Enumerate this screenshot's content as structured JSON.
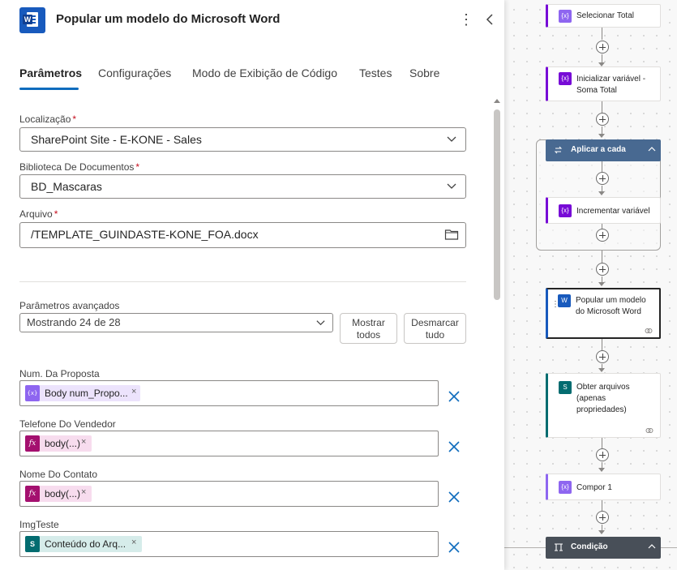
{
  "header": {
    "title": "Popular um modelo do Microsoft Word",
    "more_icon": "more-vertical-icon",
    "collapse_icon": "chevron-left-icon"
  },
  "tabs": [
    {
      "label": "Parâmetros",
      "active": true
    },
    {
      "label": "Configurações",
      "active": false
    },
    {
      "label": "Modo de Exibição de Código",
      "active": false
    },
    {
      "label": "Testes",
      "active": false
    },
    {
      "label": "Sobre",
      "active": false
    }
  ],
  "form": {
    "location": {
      "label": "Localização",
      "required": "*",
      "value": "SharePoint Site - E-KONE - Sales"
    },
    "library": {
      "label": "Biblioteca De Documentos",
      "required": "*",
      "value": "BD_Mascaras"
    },
    "file": {
      "label": "Arquivo",
      "required": "*",
      "value": "/TEMPLATE_GUINDASTE-KONE_FOA.docx"
    }
  },
  "advanced": {
    "label": "Parâmetros avançados",
    "selected": "Mostrando 24 de 28",
    "show_all": [
      "Mostrar",
      "todos"
    ],
    "clear_all": [
      "Desmarcar",
      "tudo"
    ]
  },
  "params": [
    {
      "label": "Num. Da Proposta",
      "token": "Body num_Propo...",
      "token_kind": "variable",
      "icon": "{x}"
    },
    {
      "label": "Telefone Do Vendedor",
      "token": "body(...)",
      "token_kind": "expression",
      "icon": "fx"
    },
    {
      "label": "Nome Do Contato",
      "token": "body(...)",
      "token_kind": "expression",
      "icon": "fx"
    },
    {
      "label": "ImgTeste",
      "token": "Conteúdo do Arq...",
      "token_kind": "sharepoint",
      "icon": "S"
    }
  ],
  "token_close": "×",
  "flow": {
    "steps": [
      {
        "title": "Selecionar Total",
        "icon": "{x}"
      },
      {
        "title": "Inicializar variável - Soma Total",
        "lines": [
          "Inicializar variável -",
          "Soma Total"
        ],
        "icon": "{x}"
      },
      {
        "title": "Aplicar a cada"
      },
      {
        "title": "Incrementar variável",
        "icon": "{x}"
      },
      {
        "title": "Popular um modelo do Microsoft Word",
        "lines": [
          "Popular um modelo",
          "do Microsoft Word"
        ]
      },
      {
        "title": "Obter arquivos (apenas propriedades)",
        "lines": [
          "Obter arquivos",
          "(apenas",
          "propriedades)"
        ]
      },
      {
        "title": "Compor 1",
        "icon": "{x}"
      },
      {
        "title": "Condição"
      }
    ]
  },
  "colors": {
    "accent": "#0f6cbd",
    "variable": "#770bd6",
    "expression": "#a4106f",
    "sharepoint": "#036c70",
    "word": "#185abd",
    "loop": "#486991",
    "condition": "#484f58"
  }
}
